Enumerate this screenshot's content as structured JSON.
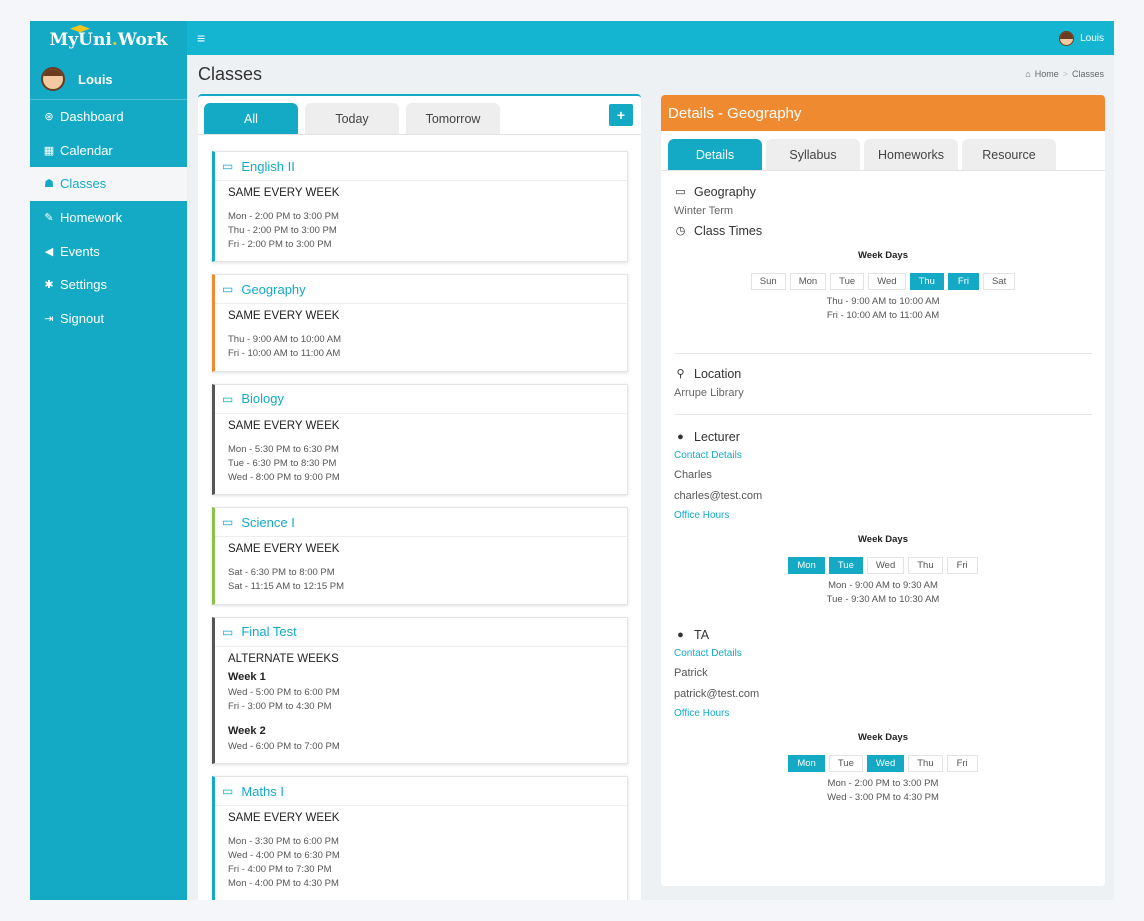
{
  "brand": {
    "name_a": "MyUni",
    "name_dot": ".",
    "name_b": "Work"
  },
  "user": {
    "name": "Louis"
  },
  "sidebar": {
    "items": [
      {
        "label": "Dashboard",
        "icon": "⊛"
      },
      {
        "label": "Calendar",
        "icon": "▦"
      },
      {
        "label": "Classes",
        "icon": "☗"
      },
      {
        "label": "Homework",
        "icon": "✎"
      },
      {
        "label": "Events",
        "icon": "◀"
      },
      {
        "label": "Settings",
        "icon": "✱"
      },
      {
        "label": "Signout",
        "icon": "⇥"
      }
    ]
  },
  "page": {
    "title": "Classes"
  },
  "breadcrumb": {
    "home": "Home",
    "sep": ">",
    "current": "Classes"
  },
  "left_tabs": [
    "All",
    "Today",
    "Tomorrow"
  ],
  "add_label": "+",
  "classes": [
    {
      "name": "English II",
      "freq": "SAME EVERY WEEK",
      "times": [
        "Mon - 2:00 PM to 3:00 PM",
        "Thu - 2:00 PM to 3:00 PM",
        "Fri - 2:00 PM to 3:00 PM"
      ]
    },
    {
      "name": "Geography",
      "freq": "SAME EVERY WEEK",
      "times": [
        "Thu - 9:00 AM to 10:00 AM",
        "Fri - 10:00 AM to 11:00 AM"
      ]
    },
    {
      "name": "Biology",
      "freq": "SAME EVERY WEEK",
      "times": [
        "Mon - 5:30 PM to 6:30 PM",
        "Tue - 6:30 PM to 8:30 PM",
        "Wed - 8:00 PM to 9:00 PM"
      ]
    },
    {
      "name": "Science I",
      "freq": "SAME EVERY WEEK",
      "times": [
        "Sat - 6:30 PM to 8:00 PM",
        "Sat - 11:15 AM to 12:15 PM"
      ]
    },
    {
      "name": "Final Test",
      "freq": "ALTERNATE WEEKS",
      "week1": "Week 1",
      "week1_times": [
        "Wed - 5:00 PM to 6:00 PM",
        "Fri - 3:00 PM to 4:30 PM"
      ],
      "week2": "Week 2",
      "week2_times": [
        "Wed - 6:00 PM to 7:00 PM"
      ]
    },
    {
      "name": "Maths I",
      "freq": "SAME EVERY WEEK",
      "times": [
        "Mon - 3:30 PM to 6:00 PM",
        "Wed - 4:00 PM to 6:30 PM",
        "Fri - 4:00 PM to 7:30 PM",
        "Mon - 4:00 PM to 4:30 PM"
      ]
    }
  ],
  "details": {
    "header": "Details - Geography",
    "tabs": [
      "Details",
      "Syllabus",
      "Homeworks",
      "Resource"
    ],
    "course_name": "Geography",
    "term": "Winter Term",
    "class_times_label": "Class Times",
    "week_days_label": "Week Days",
    "class_days": [
      "Sun",
      "Mon",
      "Tue",
      "Wed",
      "Thu",
      "Fri",
      "Sat"
    ],
    "class_active": [
      "Thu",
      "Fri"
    ],
    "class_slots": [
      "Thu - 9:00 AM to 10:00 AM",
      "Fri - 10:00 AM to 11:00 AM"
    ],
    "location_label": "Location",
    "location": "Arrupe Library",
    "lecturer_label": "Lecturer",
    "contact_label": "Contact Details",
    "lecturer_name": "Charles",
    "lecturer_email": "charles@test.com",
    "office_hours_label": "Office Hours",
    "lecturer_days": [
      "Mon",
      "Tue",
      "Wed",
      "Thu",
      "Fri"
    ],
    "lecturer_active": [
      "Mon",
      "Tue"
    ],
    "lecturer_slots": [
      "Mon - 9:00 AM to 9:30 AM",
      "Tue - 9:30 AM to 10:30 AM"
    ],
    "ta_label": "TA",
    "ta_name": "Patrick",
    "ta_email": "patrick@test.com",
    "ta_days": [
      "Mon",
      "Tue",
      "Wed",
      "Thu",
      "Fri"
    ],
    "ta_active": [
      "Mon",
      "Wed"
    ],
    "ta_slots": [
      "Mon - 2:00 PM to 3:00 PM",
      "Wed - 3:00 PM to 4:30 PM"
    ]
  },
  "colors": {
    "primary": "#14aac6",
    "accent": "#f08a30"
  }
}
